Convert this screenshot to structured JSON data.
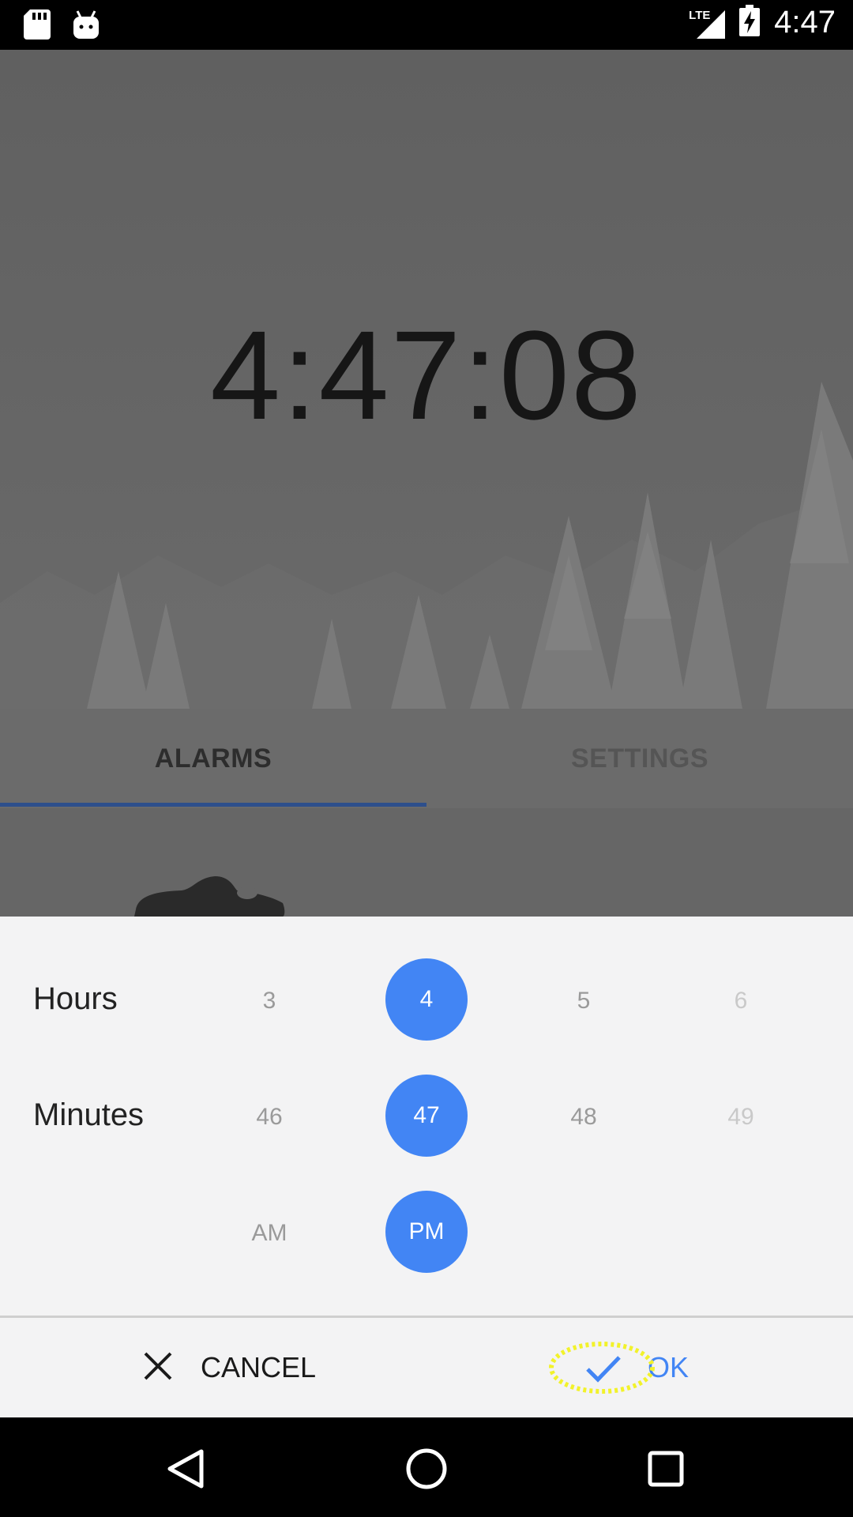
{
  "status_bar": {
    "left_icons": [
      "sd-card-icon",
      "android-icon"
    ],
    "network_label": "LTE",
    "time": "4:47"
  },
  "clock": {
    "time": "4:47:08"
  },
  "tabs": [
    {
      "label": "ALARMS",
      "selected": true
    },
    {
      "label": "SETTINGS",
      "selected": false
    }
  ],
  "picker": {
    "hours": {
      "label": "Hours",
      "values": [
        "3",
        "4",
        "5",
        "6"
      ],
      "selected": "4"
    },
    "minutes": {
      "label": "Minutes",
      "values": [
        "46",
        "47",
        "48",
        "49"
      ],
      "selected": "47"
    },
    "period": {
      "values": [
        "AM",
        "PM"
      ],
      "selected": "PM"
    }
  },
  "actions": {
    "cancel_label": "CANCEL",
    "ok_label": "OK"
  },
  "colors": {
    "accent": "#4285f4",
    "tab_indicator": "#2d4f8c"
  }
}
